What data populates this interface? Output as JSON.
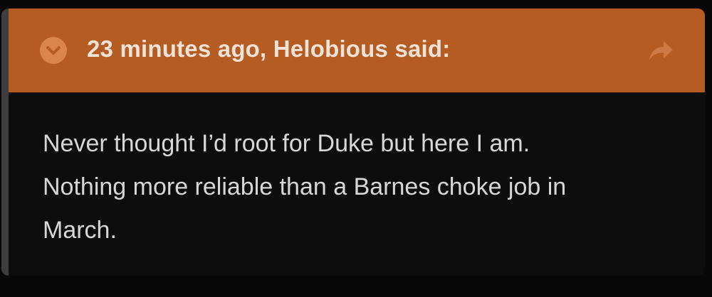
{
  "quote": {
    "citation": "23 minutes ago, Helobious said:",
    "body_lines": [
      "Never thought I’d root for Duke but here I am.",
      "Nothing more reliable than a Barnes choke job in",
      "March."
    ],
    "icons": {
      "expand": "chevron-down-circle-icon",
      "share": "share-arrow-icon"
    }
  },
  "colors": {
    "header_bg": "#b45c21",
    "body_bg": "#0d0d0d",
    "page_bg": "#080808",
    "header_text": "#f0e2d6",
    "body_text": "#d7d7d7"
  }
}
